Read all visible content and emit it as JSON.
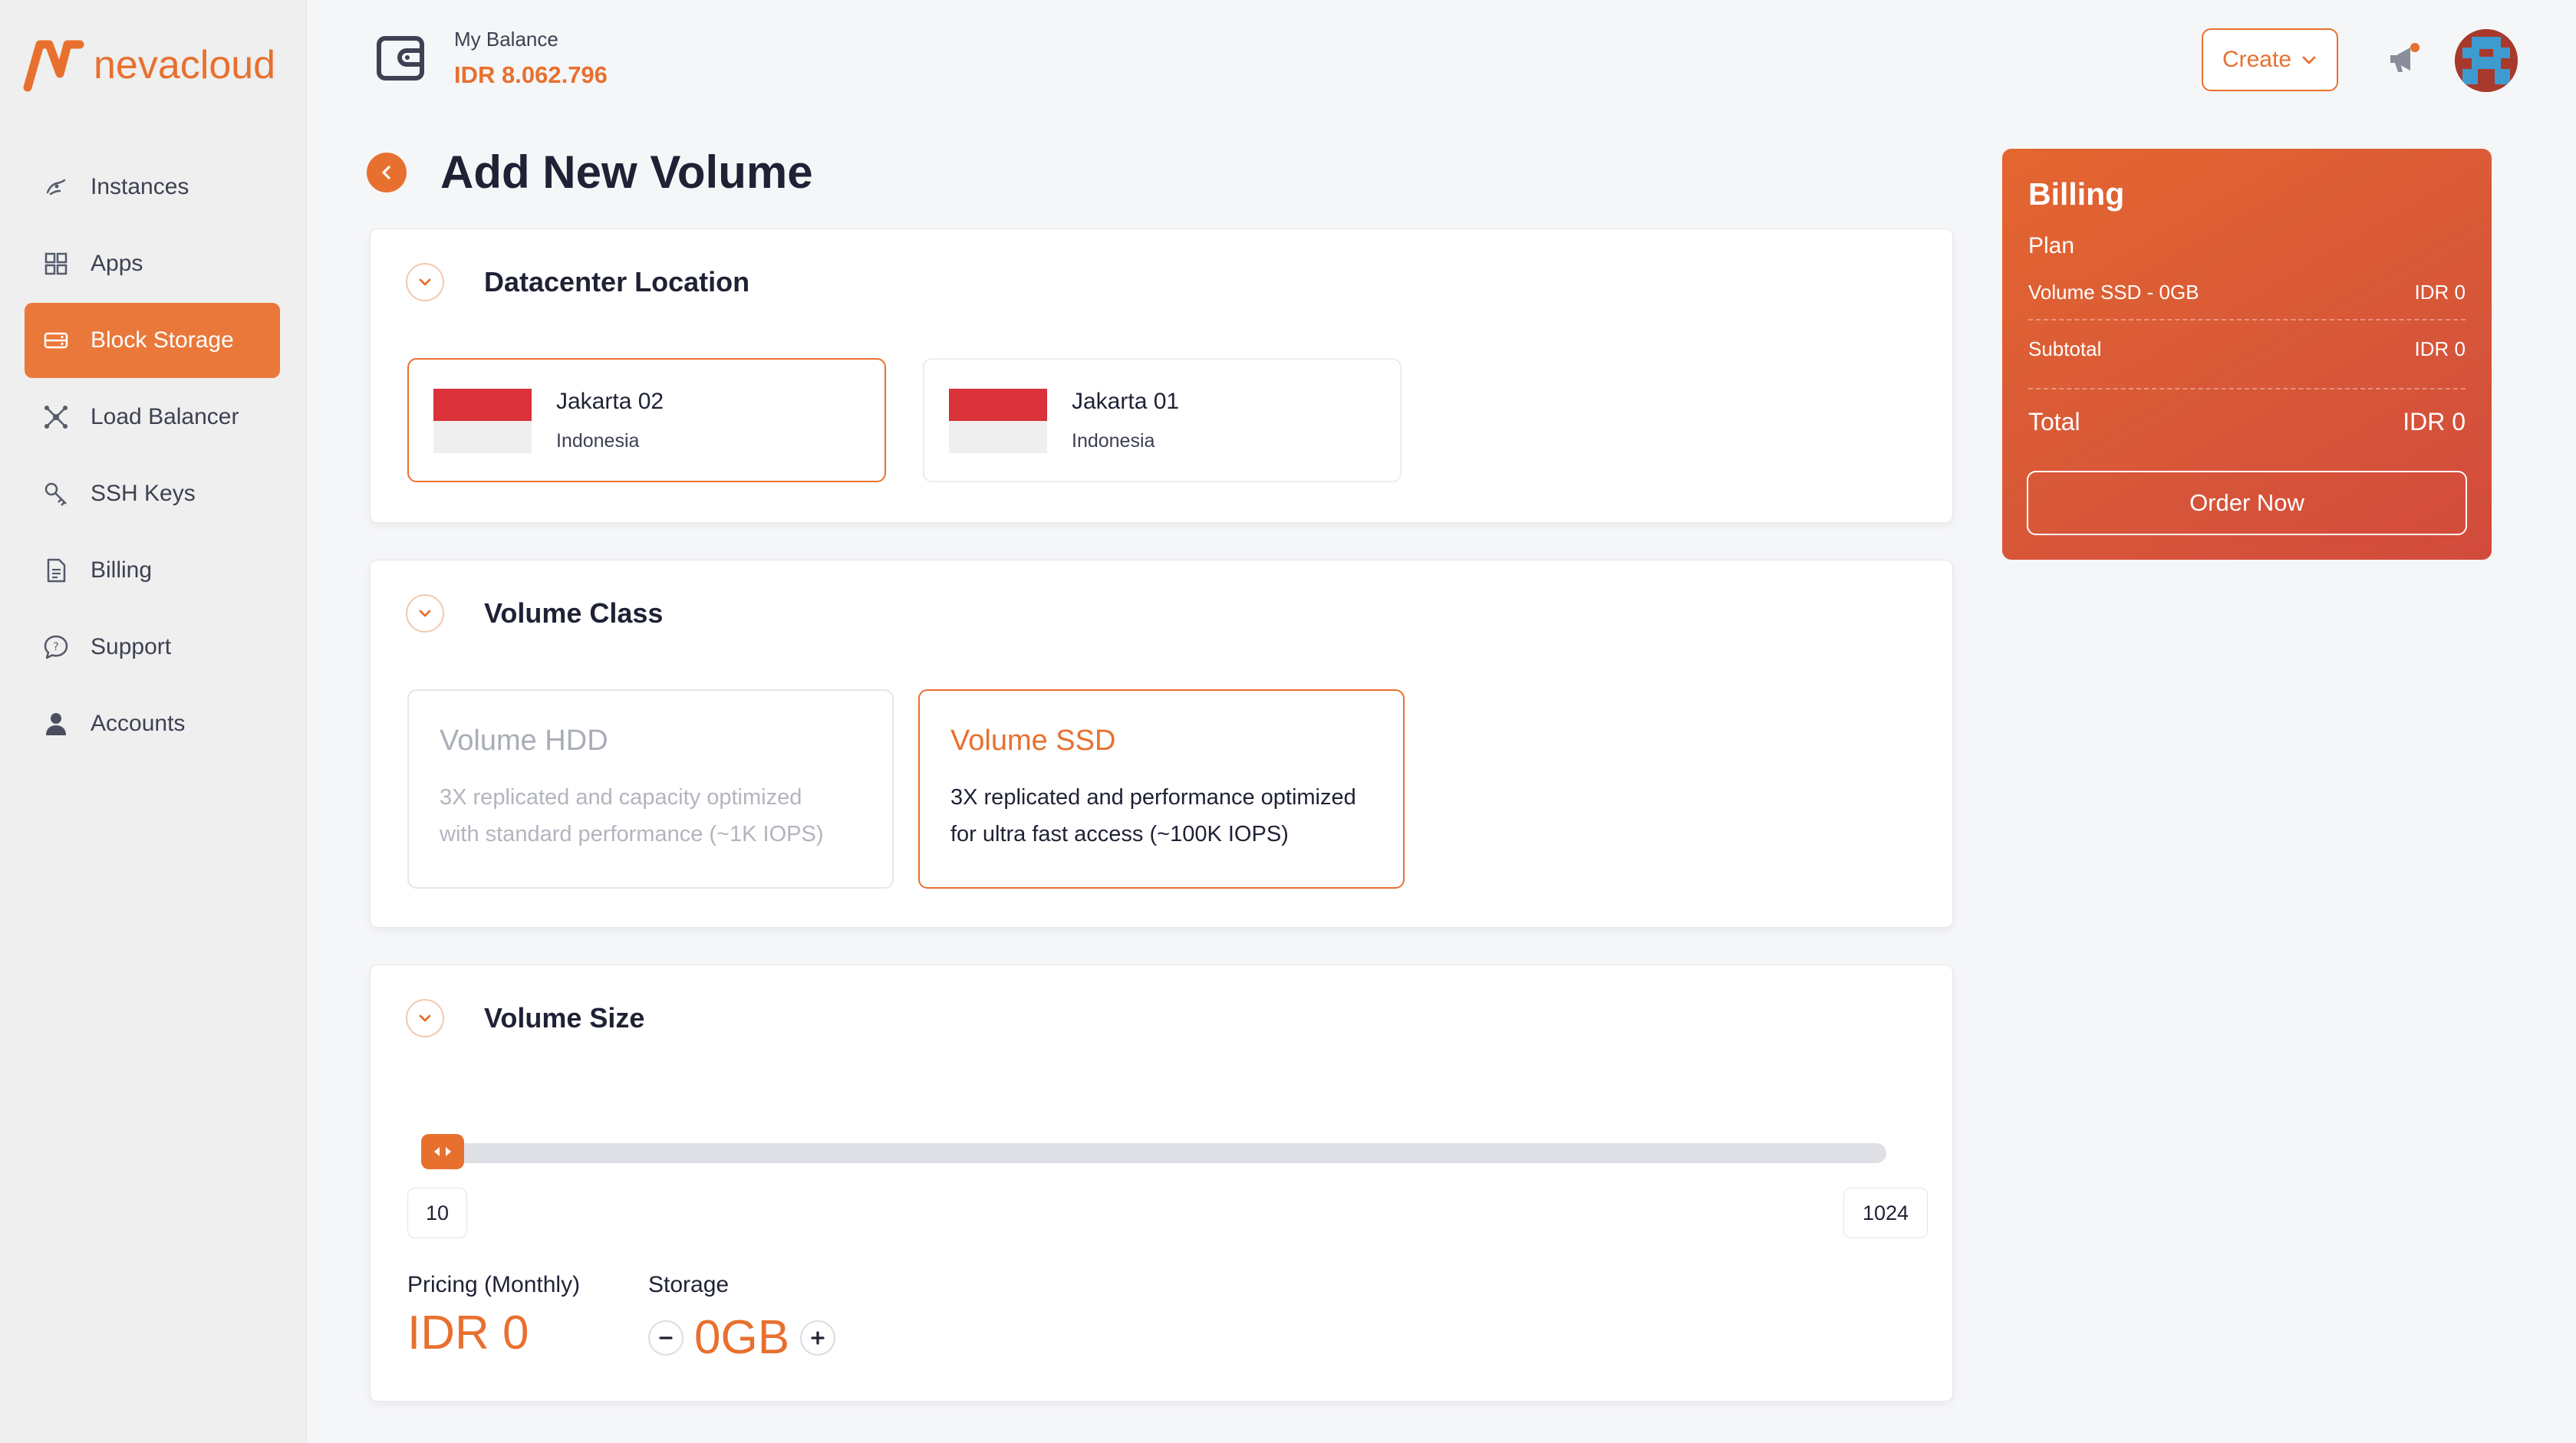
{
  "brand": {
    "name": "nevacloud",
    "accent": "#e8702f"
  },
  "sidebar": {
    "items": [
      {
        "label": "Instances",
        "icon": "instances-icon",
        "active": false
      },
      {
        "label": "Apps",
        "icon": "apps-grid-icon",
        "active": false
      },
      {
        "label": "Block Storage",
        "icon": "storage-icon",
        "active": true
      },
      {
        "label": "Load Balancer",
        "icon": "load-balancer-icon",
        "active": false
      },
      {
        "label": "SSH Keys",
        "icon": "key-icon",
        "active": false
      },
      {
        "label": "Billing",
        "icon": "document-icon",
        "active": false
      },
      {
        "label": "Support",
        "icon": "support-chat-icon",
        "active": false
      },
      {
        "label": "Accounts",
        "icon": "user-icon",
        "active": false
      }
    ]
  },
  "header": {
    "balance_label": "My Balance",
    "balance_value": "IDR 8.062.796",
    "create_label": "Create"
  },
  "page": {
    "title": "Add New Volume"
  },
  "datacenter": {
    "title": "Datacenter Location",
    "options": [
      {
        "name": "Jakarta 02",
        "country": "Indonesia",
        "selected": true
      },
      {
        "name": "Jakarta 01",
        "country": "Indonesia",
        "selected": false
      }
    ]
  },
  "volume_class": {
    "title": "Volume Class",
    "options": [
      {
        "name": "Volume HDD",
        "line1": "3X replicated and capacity optimized",
        "line2": "with standard performance (~1K IOPS)",
        "selected": false
      },
      {
        "name": "Volume SSD",
        "line1": "3X replicated and performance optimized",
        "line2": "for ultra fast access (~100K IOPS)",
        "selected": true
      }
    ]
  },
  "volume_size": {
    "title": "Volume Size",
    "min": "10",
    "max": "1024",
    "pricing_label": "Pricing (Monthly)",
    "pricing_value": "IDR 0",
    "storage_label": "Storage",
    "storage_value": "0GB"
  },
  "billing": {
    "title": "Billing",
    "plan_label": "Plan",
    "rows": [
      {
        "label": "Volume SSD - 0GB",
        "value": "IDR 0"
      },
      {
        "label": "Subtotal",
        "value": "IDR 0"
      },
      {
        "label": "Total",
        "value": "IDR 0"
      }
    ],
    "order_label": "Order Now"
  }
}
